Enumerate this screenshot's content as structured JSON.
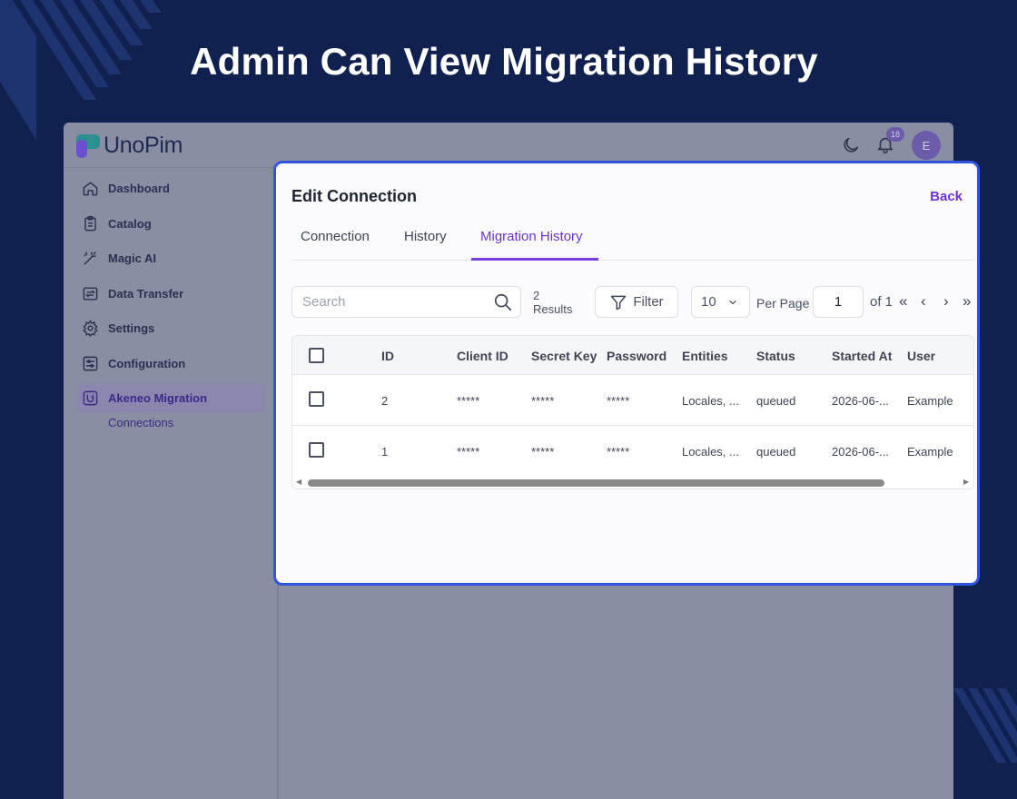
{
  "headline": "Admin Can View Migration History",
  "app": {
    "logo_text": "UnoPim",
    "notifications_count": "18",
    "user_initial": "E"
  },
  "sidebar": {
    "items": [
      {
        "label": "Dashboard",
        "icon": "home-icon"
      },
      {
        "label": "Catalog",
        "icon": "clipboard-icon"
      },
      {
        "label": "Magic AI",
        "icon": "magic-wand-icon"
      },
      {
        "label": "Data Transfer",
        "icon": "transfer-icon"
      },
      {
        "label": "Settings",
        "icon": "gear-icon"
      },
      {
        "label": "Configuration",
        "icon": "sliders-icon"
      },
      {
        "label": "Akeneo Migration",
        "icon": "migration-icon",
        "active": true
      }
    ],
    "sub_items": [
      {
        "label": "Connections"
      }
    ]
  },
  "modal": {
    "title": "Edit Connection",
    "back_label": "Back",
    "tabs": [
      {
        "label": "Connection"
      },
      {
        "label": "History"
      },
      {
        "label": "Migration History",
        "active": true
      }
    ]
  },
  "toolbar": {
    "search_placeholder": "Search",
    "results_count": "2",
    "results_label": "Results",
    "filter_label": "Filter",
    "per_page_value": "10",
    "per_page_label": "Per Page",
    "page_value": "1",
    "page_of": "of 1"
  },
  "table": {
    "columns": [
      "ID",
      "Client ID",
      "Secret Key",
      "Password",
      "Entities",
      "Status",
      "Started At",
      "User"
    ],
    "rows": [
      [
        "2",
        "*****",
        "*****",
        "*****",
        "Locales, ...",
        "queued",
        "2026-06-...",
        "Example"
      ],
      [
        "1",
        "*****",
        "*****",
        "*****",
        "Locales, ...",
        "queued",
        "2026-06-...",
        "Example"
      ]
    ]
  },
  "colors": {
    "background": "#10204f",
    "accent": "#6d32d6",
    "highlight_border": "#2f54e0"
  }
}
